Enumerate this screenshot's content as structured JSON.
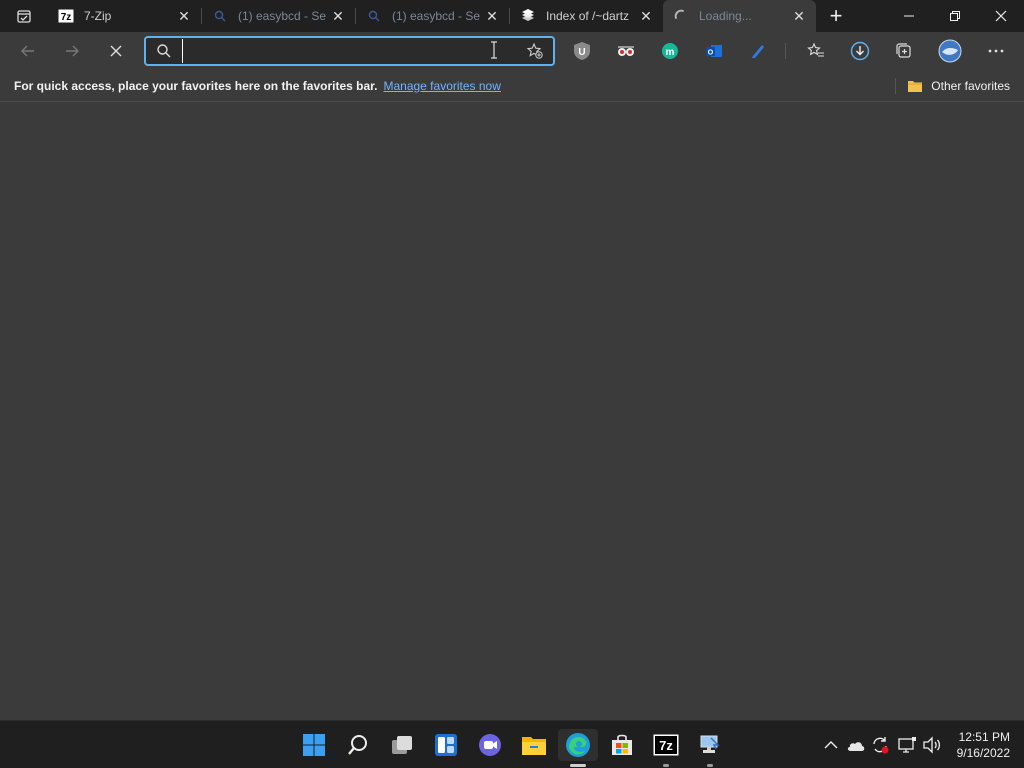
{
  "tabs": [
    {
      "title": "7-Zip",
      "favicon": "7zip-icon",
      "faded": false,
      "active": false
    },
    {
      "title": "(1) easybcd - Se",
      "favicon": "search-icon",
      "faded": true,
      "active": false
    },
    {
      "title": "(1) easybcd - Se",
      "favicon": "search-icon",
      "faded": true,
      "active": false
    },
    {
      "title": "Index of /~dartz",
      "favicon": "server-icon",
      "faded": false,
      "active": false
    },
    {
      "title": "Loading...",
      "favicon": "loading-spinner-icon",
      "faded": true,
      "active": true
    }
  ],
  "address": {
    "value": "",
    "placeholder": ""
  },
  "favorites_bar": {
    "message": "For quick access, place your favorites here on the favorites bar.",
    "link": "Manage favorites now",
    "other": "Other favorites"
  },
  "clock": {
    "time": "12:51 PM",
    "date": "9/16/2022"
  },
  "colors": {
    "accent": "#5fb2f2",
    "link": "#6fb5ff",
    "folder": "#f2c14e"
  }
}
